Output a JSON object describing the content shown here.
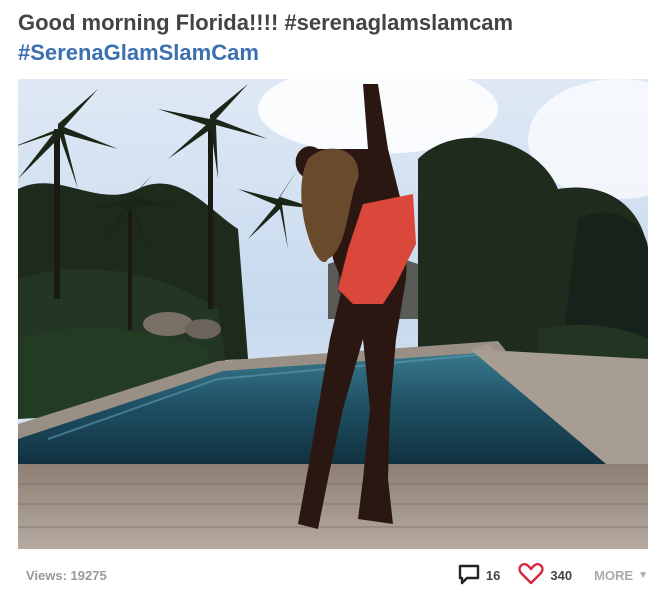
{
  "post": {
    "caption_text": "Good morning Florida!!!! #serenaglamslamcam",
    "caption_hashtag": "#SerenaGlamSlamCam",
    "photo_icon": "photo-image"
  },
  "footer": {
    "views_label": "Views: 19275",
    "comment_count": "16",
    "like_count": "340",
    "more_label": "MORE",
    "comment_icon": "speech-bubble-icon",
    "like_icon": "heart-outline-icon",
    "more_icon": "caret-down-icon"
  },
  "colors": {
    "caption_text": "#444444",
    "hashtag": "#3a6fb0",
    "like_heart": "#d6263b",
    "muted": "#999999"
  }
}
